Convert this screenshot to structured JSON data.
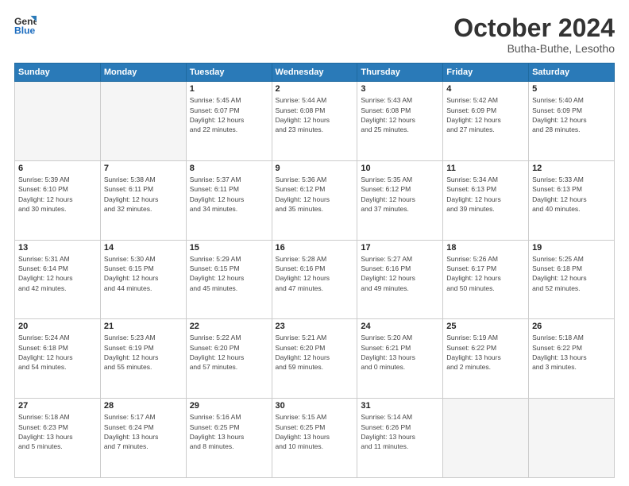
{
  "header": {
    "logo_line1": "General",
    "logo_line2": "Blue",
    "title": "October 2024",
    "subtitle": "Butha-Buthe, Lesotho"
  },
  "weekdays": [
    "Sunday",
    "Monday",
    "Tuesday",
    "Wednesday",
    "Thursday",
    "Friday",
    "Saturday"
  ],
  "weeks": [
    [
      {
        "day": "",
        "info": ""
      },
      {
        "day": "",
        "info": ""
      },
      {
        "day": "1",
        "info": "Sunrise: 5:45 AM\nSunset: 6:07 PM\nDaylight: 12 hours\nand 22 minutes."
      },
      {
        "day": "2",
        "info": "Sunrise: 5:44 AM\nSunset: 6:08 PM\nDaylight: 12 hours\nand 23 minutes."
      },
      {
        "day": "3",
        "info": "Sunrise: 5:43 AM\nSunset: 6:08 PM\nDaylight: 12 hours\nand 25 minutes."
      },
      {
        "day": "4",
        "info": "Sunrise: 5:42 AM\nSunset: 6:09 PM\nDaylight: 12 hours\nand 27 minutes."
      },
      {
        "day": "5",
        "info": "Sunrise: 5:40 AM\nSunset: 6:09 PM\nDaylight: 12 hours\nand 28 minutes."
      }
    ],
    [
      {
        "day": "6",
        "info": "Sunrise: 5:39 AM\nSunset: 6:10 PM\nDaylight: 12 hours\nand 30 minutes."
      },
      {
        "day": "7",
        "info": "Sunrise: 5:38 AM\nSunset: 6:11 PM\nDaylight: 12 hours\nand 32 minutes."
      },
      {
        "day": "8",
        "info": "Sunrise: 5:37 AM\nSunset: 6:11 PM\nDaylight: 12 hours\nand 34 minutes."
      },
      {
        "day": "9",
        "info": "Sunrise: 5:36 AM\nSunset: 6:12 PM\nDaylight: 12 hours\nand 35 minutes."
      },
      {
        "day": "10",
        "info": "Sunrise: 5:35 AM\nSunset: 6:12 PM\nDaylight: 12 hours\nand 37 minutes."
      },
      {
        "day": "11",
        "info": "Sunrise: 5:34 AM\nSunset: 6:13 PM\nDaylight: 12 hours\nand 39 minutes."
      },
      {
        "day": "12",
        "info": "Sunrise: 5:33 AM\nSunset: 6:13 PM\nDaylight: 12 hours\nand 40 minutes."
      }
    ],
    [
      {
        "day": "13",
        "info": "Sunrise: 5:31 AM\nSunset: 6:14 PM\nDaylight: 12 hours\nand 42 minutes."
      },
      {
        "day": "14",
        "info": "Sunrise: 5:30 AM\nSunset: 6:15 PM\nDaylight: 12 hours\nand 44 minutes."
      },
      {
        "day": "15",
        "info": "Sunrise: 5:29 AM\nSunset: 6:15 PM\nDaylight: 12 hours\nand 45 minutes."
      },
      {
        "day": "16",
        "info": "Sunrise: 5:28 AM\nSunset: 6:16 PM\nDaylight: 12 hours\nand 47 minutes."
      },
      {
        "day": "17",
        "info": "Sunrise: 5:27 AM\nSunset: 6:16 PM\nDaylight: 12 hours\nand 49 minutes."
      },
      {
        "day": "18",
        "info": "Sunrise: 5:26 AM\nSunset: 6:17 PM\nDaylight: 12 hours\nand 50 minutes."
      },
      {
        "day": "19",
        "info": "Sunrise: 5:25 AM\nSunset: 6:18 PM\nDaylight: 12 hours\nand 52 minutes."
      }
    ],
    [
      {
        "day": "20",
        "info": "Sunrise: 5:24 AM\nSunset: 6:18 PM\nDaylight: 12 hours\nand 54 minutes."
      },
      {
        "day": "21",
        "info": "Sunrise: 5:23 AM\nSunset: 6:19 PM\nDaylight: 12 hours\nand 55 minutes."
      },
      {
        "day": "22",
        "info": "Sunrise: 5:22 AM\nSunset: 6:20 PM\nDaylight: 12 hours\nand 57 minutes."
      },
      {
        "day": "23",
        "info": "Sunrise: 5:21 AM\nSunset: 6:20 PM\nDaylight: 12 hours\nand 59 minutes."
      },
      {
        "day": "24",
        "info": "Sunrise: 5:20 AM\nSunset: 6:21 PM\nDaylight: 13 hours\nand 0 minutes."
      },
      {
        "day": "25",
        "info": "Sunrise: 5:19 AM\nSunset: 6:22 PM\nDaylight: 13 hours\nand 2 minutes."
      },
      {
        "day": "26",
        "info": "Sunrise: 5:18 AM\nSunset: 6:22 PM\nDaylight: 13 hours\nand 3 minutes."
      }
    ],
    [
      {
        "day": "27",
        "info": "Sunrise: 5:18 AM\nSunset: 6:23 PM\nDaylight: 13 hours\nand 5 minutes."
      },
      {
        "day": "28",
        "info": "Sunrise: 5:17 AM\nSunset: 6:24 PM\nDaylight: 13 hours\nand 7 minutes."
      },
      {
        "day": "29",
        "info": "Sunrise: 5:16 AM\nSunset: 6:25 PM\nDaylight: 13 hours\nand 8 minutes."
      },
      {
        "day": "30",
        "info": "Sunrise: 5:15 AM\nSunset: 6:25 PM\nDaylight: 13 hours\nand 10 minutes."
      },
      {
        "day": "31",
        "info": "Sunrise: 5:14 AM\nSunset: 6:26 PM\nDaylight: 13 hours\nand 11 minutes."
      },
      {
        "day": "",
        "info": ""
      },
      {
        "day": "",
        "info": ""
      }
    ]
  ]
}
